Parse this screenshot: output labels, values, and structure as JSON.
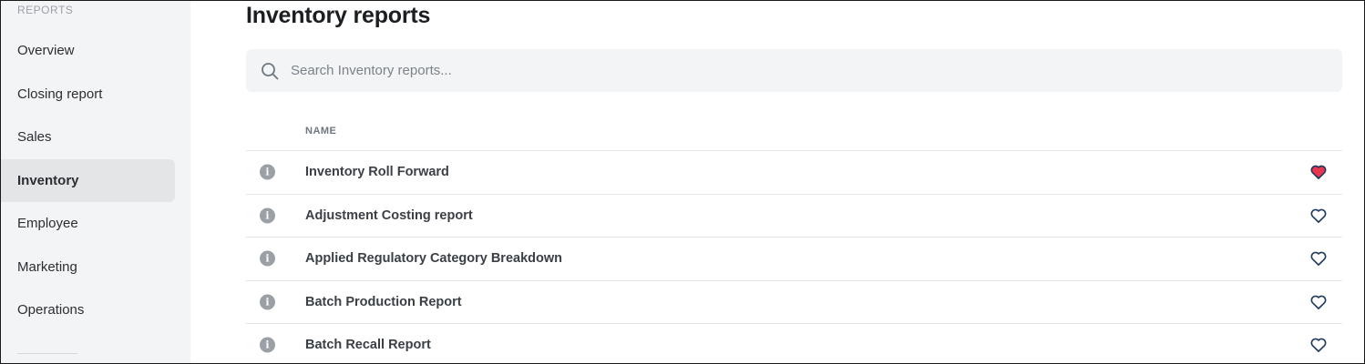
{
  "sidebar": {
    "heading": "REPORTS",
    "items": [
      {
        "label": "Overview",
        "active": false
      },
      {
        "label": "Closing report",
        "active": false
      },
      {
        "label": "Sales",
        "active": false
      },
      {
        "label": "Inventory",
        "active": true
      },
      {
        "label": "Employee",
        "active": false
      },
      {
        "label": "Marketing",
        "active": false
      },
      {
        "label": "Operations",
        "active": false
      }
    ]
  },
  "main": {
    "title": "Inventory reports",
    "search": {
      "placeholder": "Search Inventory reports...",
      "value": "",
      "icon": "search-icon"
    },
    "table": {
      "column_header": "NAME",
      "rows": [
        {
          "name": "Inventory Roll Forward",
          "favorite": true
        },
        {
          "name": "Adjustment Costing report",
          "favorite": false
        },
        {
          "name": "Applied Regulatory Category Breakdown",
          "favorite": false
        },
        {
          "name": "Batch Production Report",
          "favorite": false
        },
        {
          "name": "Batch Recall Report",
          "favorite": false
        }
      ]
    }
  },
  "colors": {
    "favorite_active": "#e8364f",
    "favorite_inactive": "#1f3a5f",
    "info_icon": "#9aa0a6",
    "sidebar_bg": "#f3f4f5",
    "active_item_bg": "#e4e5e7"
  }
}
